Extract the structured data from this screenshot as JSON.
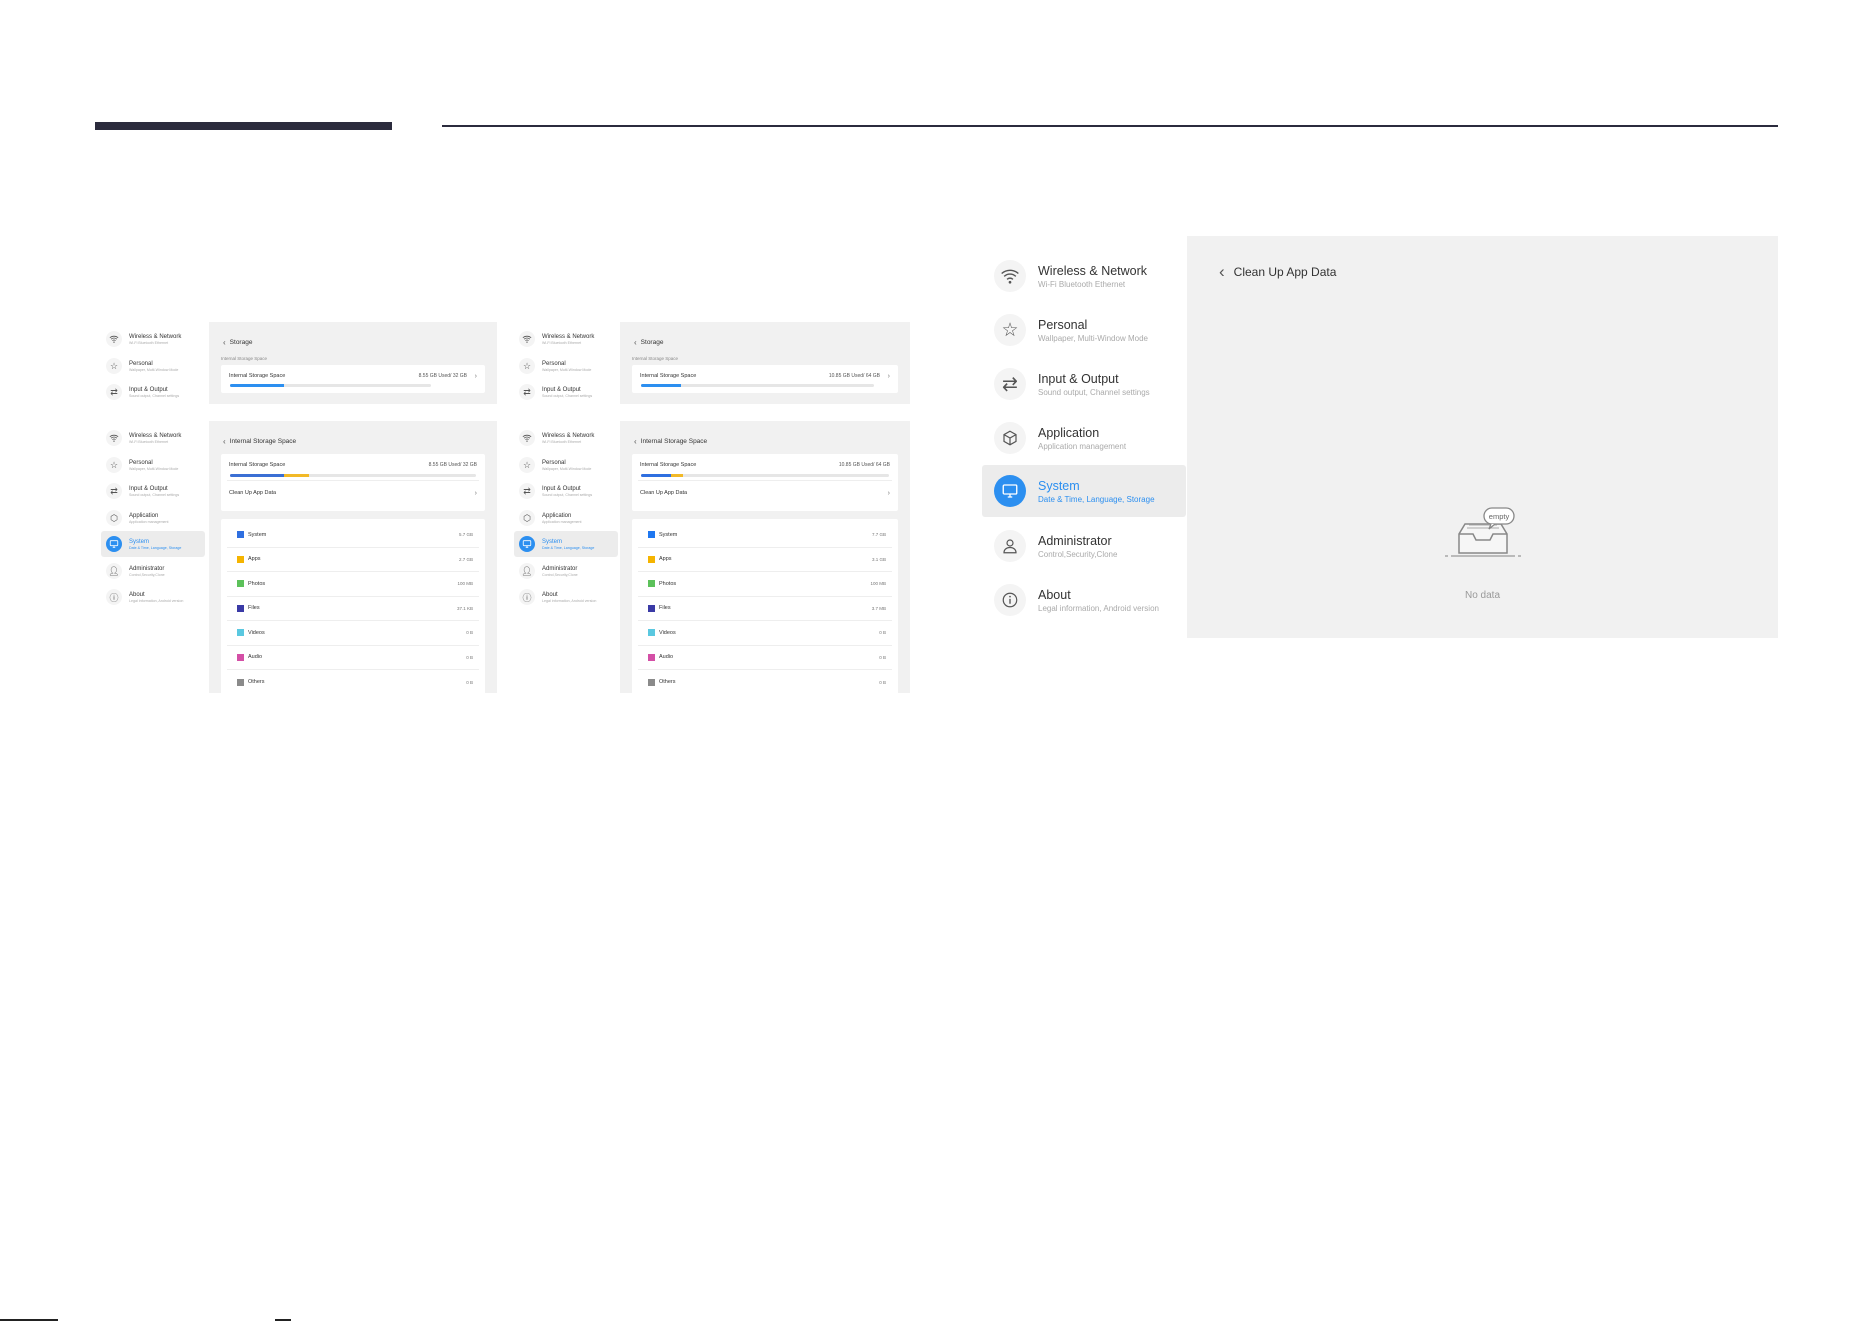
{
  "nav": {
    "wireless": {
      "label": "Wireless & Network",
      "sub": "Wi-Fi Bluetooth Ethernet",
      "icon": "wifi-icon"
    },
    "personal": {
      "label": "Personal",
      "sub": "Wallpaper, Multi-Window Mode",
      "icon": "star-icon"
    },
    "input": {
      "label": "Input & Output",
      "sub": "Sound output, Channel settings",
      "icon": "arrows-icon"
    },
    "application": {
      "label": "Application",
      "sub": "Application management",
      "icon": "cube-icon"
    },
    "system": {
      "label": "System",
      "sub": "Date & Time, Language, Storage",
      "icon": "monitor-icon"
    },
    "administrator": {
      "label": "Administrator",
      "sub": "Control,Security,Clone",
      "icon": "person-icon"
    },
    "about": {
      "label": "About",
      "sub": "Legal information, Android version",
      "icon": "info-icon"
    }
  },
  "storage_32": {
    "back_label": "Storage",
    "section_caption": "Internal Storage Space",
    "row_label": "Internal Storage Space",
    "row_value": "8.55 GB Used/ 32 GB",
    "used_fraction": 0.27
  },
  "storage_64": {
    "back_label": "Storage",
    "section_caption": "Internal Storage Space",
    "row_label": "Internal Storage Space",
    "row_value": "10.85 GB Used/ 64 GB",
    "used_fraction": 0.17
  },
  "detail_32": {
    "back_label": "Internal Storage Space",
    "row_label": "Internal Storage Space",
    "row_value": "8.55 GB Used/ 32 GB",
    "segments": [
      {
        "color": "#3b6fd4",
        "fraction": 0.22
      },
      {
        "color": "#f2b927",
        "fraction": 0.1
      }
    ],
    "cleanup_label": "Clean Up App Data",
    "items": [
      {
        "name": "System",
        "size": "5.7 GB",
        "color": "#2f6fe0"
      },
      {
        "name": "Apps",
        "size": "2.7 GB",
        "color": "#f5b400"
      },
      {
        "name": "Photos",
        "size": "100 MB",
        "color": "#5cc15a"
      },
      {
        "name": "Files",
        "size": "37.1 KB",
        "color": "#3a3aa6"
      },
      {
        "name": "Videos",
        "size": "0 B",
        "color": "#5ac8e0"
      },
      {
        "name": "Audio",
        "size": "0 B",
        "color": "#d44fa6"
      },
      {
        "name": "Others",
        "size": "0 B",
        "color": "#8a8a8a"
      }
    ]
  },
  "detail_64": {
    "back_label": "Internal Storage Space",
    "row_label": "Internal Storage Space",
    "row_value": "10.85 GB Used/ 64 GB",
    "segments": [
      {
        "color": "#2f6fe0",
        "fraction": 0.12
      },
      {
        "color": "#f2b927",
        "fraction": 0.05
      }
    ],
    "cleanup_label": "Clean Up App Data",
    "items": [
      {
        "name": "System",
        "size": "7.7 GB",
        "color": "#1f77f0"
      },
      {
        "name": "Apps",
        "size": "3.1 GB",
        "color": "#f5b400"
      },
      {
        "name": "Photos",
        "size": "100 MB",
        "color": "#5cc15a"
      },
      {
        "name": "Files",
        "size": "3.7 MB",
        "color": "#3a3aa6"
      },
      {
        "name": "Videos",
        "size": "0 B",
        "color": "#5ac8e0"
      },
      {
        "name": "Audio",
        "size": "0 B",
        "color": "#d44fa6"
      },
      {
        "name": "Others",
        "size": "0 B",
        "color": "#8a8a8a"
      }
    ]
  },
  "cleanup_screen": {
    "back_label": "Clean Up App Data",
    "empty_badge": "empty",
    "empty_label": "No data"
  },
  "colors": {
    "accent": "#2c8ff0",
    "content_bg": "#f1f1f1",
    "rule": "#2b2b3d"
  }
}
